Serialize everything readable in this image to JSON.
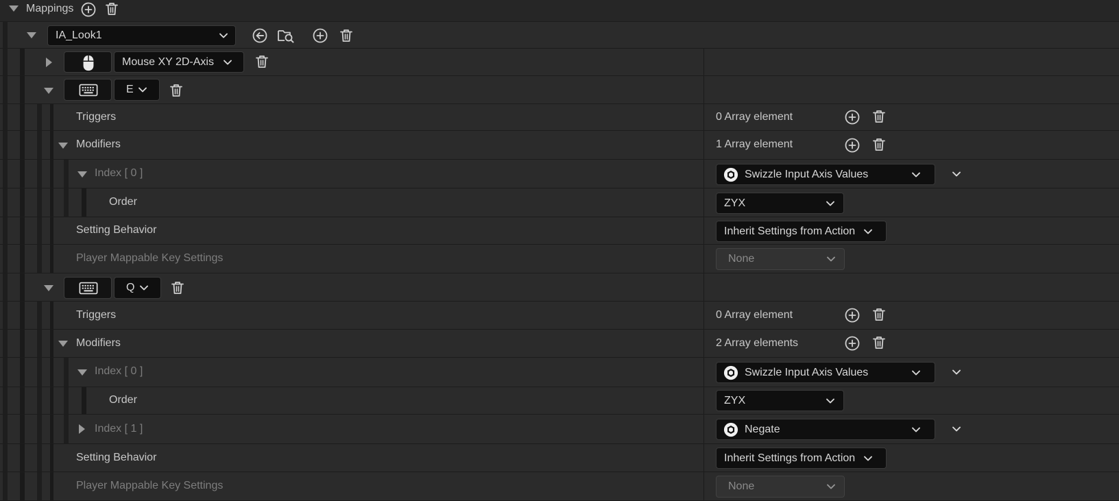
{
  "section": {
    "title": "Mappings"
  },
  "action": {
    "selected": "IA_Look1"
  },
  "mapping1": {
    "key": "Mouse XY 2D-Axis"
  },
  "mapping2": {
    "key": "E",
    "triggers_label": "Triggers",
    "triggers_count": "0 Array element",
    "modifiers_label": "Modifiers",
    "modifiers_count": "1 Array element",
    "index0_label": "Index [ 0 ]",
    "index0_value": "Swizzle Input Axis Values",
    "order_label": "Order",
    "order_value": "ZYX",
    "setting_label": "Setting Behavior",
    "setting_value": "Inherit Settings from Action",
    "player_label": "Player Mappable Key Settings",
    "player_value": "None"
  },
  "mapping3": {
    "key": "Q",
    "triggers_label": "Triggers",
    "triggers_count": "0 Array element",
    "modifiers_label": "Modifiers",
    "modifiers_count": "2 Array elements",
    "index0_label": "Index [ 0 ]",
    "index0_value": "Swizzle Input Axis Values",
    "order_label": "Order",
    "order_value": "ZYX",
    "index1_label": "Index [ 1 ]",
    "index1_value": "Negate",
    "setting_label": "Setting Behavior",
    "setting_value": "Inherit Settings from Action",
    "player_label": "Player Mappable Key Settings",
    "player_value": "None"
  },
  "icons": {
    "add": "plus-circle-icon",
    "delete": "trash-icon",
    "expand": "chevron-down-icon",
    "mouse": "mouse-icon",
    "keyboard": "keyboard-icon",
    "back": "arrow-left-circle-icon",
    "browse": "folder-search-icon",
    "object": "cube-icon"
  },
  "colors": {
    "panel": "#242424",
    "row": "#2b2b2b",
    "combo": "#0f0f0f",
    "text": "#c8c8c8",
    "dim_text": "#7d7d7d"
  }
}
